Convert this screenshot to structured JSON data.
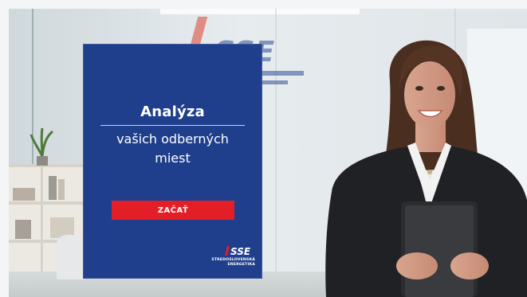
{
  "card": {
    "title": "Analýza",
    "subtitle_line1": "vašich odberných",
    "subtitle_line2": "miest",
    "start_button_label": "ZAČAŤ"
  },
  "logo": {
    "mark": "SSE",
    "line1": "STREDOSLOVENSKÁ",
    "line2": "ENERGETIKA"
  },
  "colors": {
    "card_background": "#1f3f8c",
    "button_red": "#e41e26",
    "text_white": "#ffffff"
  }
}
